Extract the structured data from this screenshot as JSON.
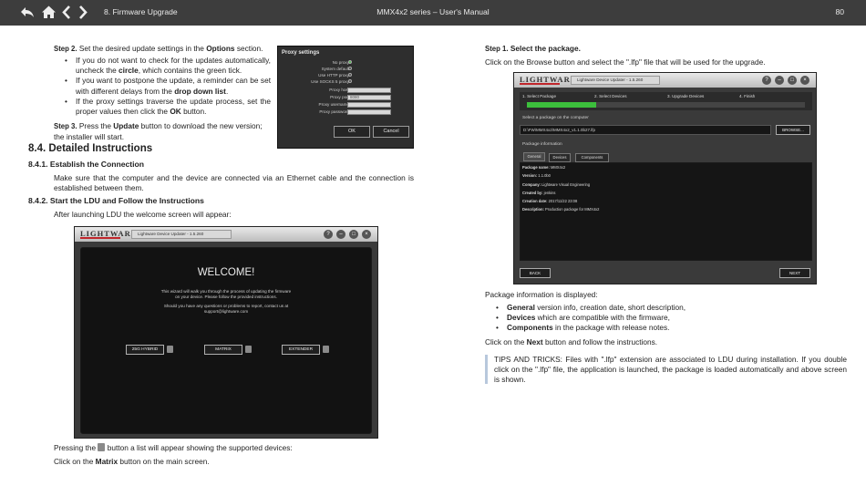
{
  "header": {
    "chapter": "8. Firmware Upgrade",
    "title": "MMX4x2 series – User's Manual",
    "page_number": "80",
    "nav_icons": [
      "back-icon",
      "home-icon",
      "previous-page-icon",
      "next-page-icon"
    ]
  },
  "left": {
    "step2_label": "Step 2.",
    "step2_text_a": "Set the desired update settings in the ",
    "step2_text_b": "Options",
    "step2_text_c": " section.",
    "bullets": [
      {
        "a": "If you do not want to check for the updates automatically, uncheck the ",
        "b": "circle",
        "c": ", which contains the green tick."
      },
      {
        "a": "If you want to postpone the update, a reminder can be set with different delays from the ",
        "b": "drop down list",
        "c": "."
      },
      {
        "a": "If the proxy settings traverse the update process, set the proper values then click the ",
        "b": "OK",
        "c": " button."
      }
    ],
    "step3_label": "Step 3.",
    "step3_text_a": "Press the ",
    "step3_text_b": "Update",
    "step3_text_c": " button to download the new version; the installer will start.",
    "section_title": "8.4.  Detailed Instructions",
    "sub1_title": "8.4.1.  Establish the Connection",
    "sub1_text": "Make sure that the computer and the device are connected via an Ethernet cable and the connection is established between them.",
    "sub2_title": "8.4.2.  Start the LDU and Follow the Instructions",
    "sub2_text": "After launching LDU the welcome screen will appear:",
    "pressing_a": "Pressing the ",
    "pressing_b": " button a list will appear showing the supported devices:",
    "click_a": "Click on the ",
    "click_b": "Matrix",
    "click_c": " button on the main screen."
  },
  "proxy_dialog": {
    "title": "Proxy settings",
    "rows": [
      "No proxy",
      "System default",
      "Use HTTP proxy",
      "Use SOCKS 5 proxy",
      "Proxy host",
      "Proxy port",
      "Proxy username",
      "Proxy password"
    ],
    "port_value": "8080",
    "ok": "OK",
    "cancel": "Cancel"
  },
  "welcome_window": {
    "logo": "LIGHTWARE",
    "window_title": "Lightware Device Updater - 1.5.260",
    "heading": "WELCOME!",
    "line1": "This wizard will walk you through the process of updating the firmware",
    "line2": "on your device. Please follow the provided instructions.",
    "line3": "Should you have any questions or problems to report, contact us at",
    "line4": "support@lightware.com",
    "buttons": [
      "25G HYBRID",
      "MATRIX",
      "EXTENDER"
    ],
    "controls": [
      "?",
      "–",
      "□",
      "×"
    ]
  },
  "right": {
    "step1_label": "Step 1.",
    "step1_title": "Select the package.",
    "step1_text": "Click on the Browse button and select the \".lfp\" file that will be used for the upgrade.",
    "pkg_displayed": "Package information is displayed:",
    "bullets": [
      {
        "b": "General",
        "c": " version info, creation date, short description,"
      },
      {
        "b": "Devices",
        "c": " which are compatible with the firmware,"
      },
      {
        "b": "Components",
        "c": " in the package with release notes."
      }
    ],
    "next_a": "Click on the ",
    "next_b": "Next",
    "next_c": " button and follow the instructions.",
    "tips": "TIPS AND TRICKS: Files with \".lfp\" extension are associated to LDU during installation. If you double click on the \".lfp\" file, the application is launched, the package is loaded automatically and above screen is shown."
  },
  "package_window": {
    "logo": "LIGHTWARE",
    "window_title": "Lightware Device Updater - 1.5.260",
    "steps": [
      "1. Select Package",
      "2. Select Devices",
      "3. Upgrade Devices",
      "4. Finish"
    ],
    "progress": 0.25,
    "select_label": "Select a package on the computer",
    "path": "D:\\FW\\MMX4x2\\MMX4x2_v1.1.0b27.lfp",
    "browse": "BROWSE...",
    "info_label": "Package information",
    "tabs": [
      "General",
      "Devices",
      "Components"
    ],
    "info": [
      {
        "k": "Package name:",
        "v": "MMX4x2"
      },
      {
        "k": "Version:",
        "v": "1.1.0b0"
      },
      {
        "k": "Company:",
        "v": "Lightware Visual Engineering"
      },
      {
        "k": "Created by:",
        "v": "jenkins"
      },
      {
        "k": "Creation date:",
        "v": "2017/11/22 23:08"
      },
      {
        "k": "Description:",
        "v": "Production package for MMX4x2"
      }
    ],
    "back": "BACK",
    "next": "NEXT"
  }
}
